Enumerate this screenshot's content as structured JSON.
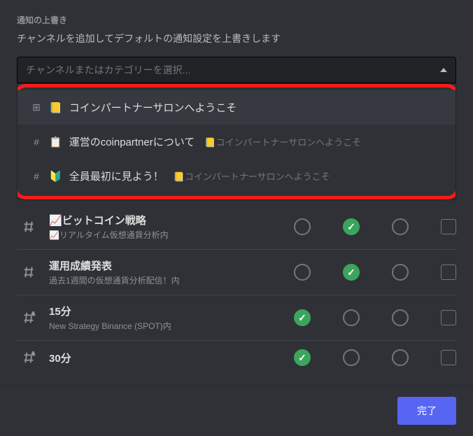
{
  "section": {
    "title": "通知の上書き",
    "description": "チャンネルを追加してデフォルトの通知設定を上書きします"
  },
  "search": {
    "placeholder": "チャンネルまたはカテゴリーを選択..."
  },
  "dropdown_items": [
    {
      "type": "category",
      "emoji": "📒",
      "label": "コインパートナーサロンへようこそ",
      "suffix": ""
    },
    {
      "type": "channel",
      "emoji": "📋",
      "label": "運営のcoinpartnerについて",
      "suffix": "📒コインパートナーサロンへようこそ"
    },
    {
      "type": "channel",
      "emoji": "🔰",
      "label": "全員最初に見よう！",
      "suffix": "📒コインパートナーサロンへようこそ"
    }
  ],
  "channels": [
    {
      "emoji": "📈",
      "name": "ビットコイン戦略",
      "sub": "📈リアルタイム仮想通貨分析内",
      "locked": false,
      "selected": 1
    },
    {
      "emoji": "",
      "name": "運用成績発表",
      "sub": "過去1週間の仮想通貨分析配信！内",
      "locked": false,
      "selected": 1
    },
    {
      "emoji": "",
      "name": "15分",
      "sub": "New Strategy Binance (SPOT)内",
      "locked": true,
      "selected": 0
    },
    {
      "emoji": "",
      "name": "30分",
      "sub": "",
      "locked": true,
      "selected": 0
    }
  ],
  "footer": {
    "done": "完了"
  }
}
